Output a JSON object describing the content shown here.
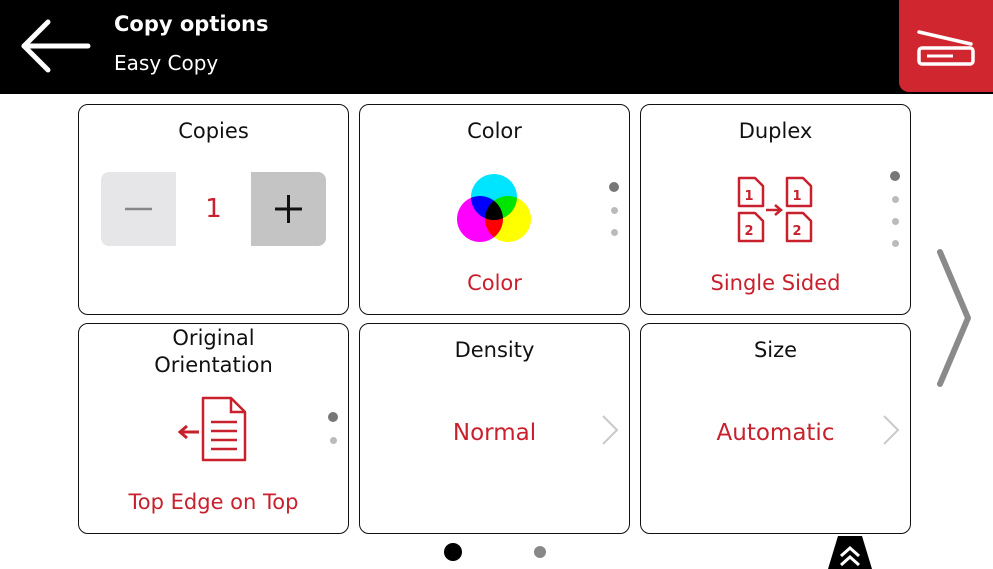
{
  "header": {
    "title": "Copy options",
    "subtitle": "Easy Copy",
    "back_icon": "arrow-left-icon",
    "scan_icon": "scanner-icon",
    "scan_color": "#d0262f"
  },
  "tiles": {
    "copies": {
      "label": "Copies",
      "value": "1",
      "minus_icon": "minus-icon",
      "plus_icon": "plus-icon"
    },
    "color": {
      "label": "Color",
      "value": "Color",
      "icon": "cmy-circles-icon"
    },
    "duplex": {
      "label": "Duplex",
      "value": "Single Sided",
      "icon": "duplex-pages-icon"
    },
    "orientation": {
      "label_line1": "Original",
      "label_line2": "Orientation",
      "value": "Top Edge on Top",
      "icon": "document-arrow-left-icon"
    },
    "density": {
      "label": "Density",
      "value": "Normal",
      "icon": "chevron-right-icon"
    },
    "size": {
      "label": "Size",
      "value": "Automatic",
      "icon": "chevron-right-icon"
    }
  },
  "pagination": {
    "current_page": 1,
    "total_pages": 2
  },
  "nav": {
    "next_icon": "chevron-right-large-icon",
    "collapse_icon": "double-chevron-up-icon"
  },
  "accent_color": "#c8202c"
}
